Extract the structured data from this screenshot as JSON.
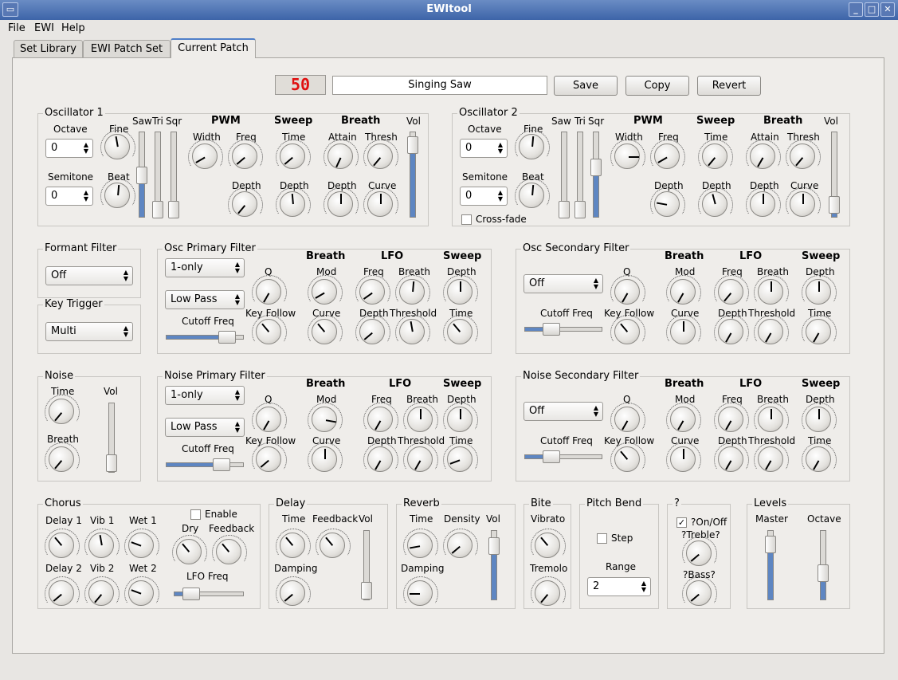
{
  "window": {
    "title": "EWItool",
    "min": "_",
    "max": "□",
    "close": "✕"
  },
  "menu": [
    "File",
    "EWI",
    "Help"
  ],
  "tabs": [
    "Set Library",
    "EWI Patch Set",
    "Current Patch"
  ],
  "patch": {
    "number": "50",
    "name": "Singing Saw",
    "save": "Save",
    "copy": "Copy",
    "revert": "Revert"
  },
  "osc1": {
    "title": "Oscillator 1",
    "octave": "Octave",
    "octave_val": "0",
    "semitone": "Semitone",
    "semitone_val": "0",
    "fine": "Fine",
    "beat": "Beat",
    "saw": "Saw",
    "tri": "Tri",
    "sqr": "Sqr",
    "pwm": "PWM",
    "sweep": "Sweep",
    "breath": "Breath",
    "vol": "Vol",
    "width": "Width",
    "freq": "Freq",
    "time": "Time",
    "attain": "Attain",
    "thresh": "Thresh",
    "depth": "Depth",
    "curve": "Curve"
  },
  "osc2": {
    "title": "Oscillator 2",
    "crossfade": "Cross-fade"
  },
  "formant": {
    "title": "Formant Filter",
    "value": "Off"
  },
  "keytrig": {
    "title": "Key Trigger",
    "value": "Multi"
  },
  "opf": {
    "title": "Osc Primary Filter",
    "mode": "1-only",
    "type": "Low Pass",
    "cutoff": "Cutoff Freq",
    "q": "Q",
    "keyfollow": "Key Follow",
    "breath": "Breath",
    "lfo": "LFO",
    "sweep": "Sweep",
    "mod": "Mod",
    "curve": "Curve",
    "freq": "Freq",
    "breath_l": "Breath",
    "depth": "Depth",
    "threshold": "Threshold",
    "time": "Time"
  },
  "osf": {
    "title": "Osc Secondary Filter",
    "mode": "Off"
  },
  "noise": {
    "title": "Noise",
    "time": "Time",
    "breath": "Breath",
    "vol": "Vol"
  },
  "npf": {
    "title": "Noise Primary Filter",
    "mode": "1-only",
    "type": "Low Pass"
  },
  "nsf": {
    "title": "Noise Secondary Filter",
    "mode": "Off"
  },
  "chorus": {
    "title": "Chorus",
    "delay1": "Delay 1",
    "vib1": "Vib 1",
    "wet1": "Wet 1",
    "delay2": "Delay 2",
    "vib2": "Vib 2",
    "wet2": "Wet 2",
    "enable": "Enable",
    "dry": "Dry",
    "feedback": "Feedback",
    "lfofreq": "LFO Freq"
  },
  "delay": {
    "title": "Delay",
    "time": "Time",
    "feedback": "Feedback",
    "vol": "Vol",
    "damping": "Damping"
  },
  "reverb": {
    "title": "Reverb",
    "time": "Time",
    "density": "Density",
    "vol": "Vol",
    "damping": "Damping"
  },
  "bite": {
    "title": "Bite",
    "vibrato": "Vibrato",
    "tremolo": "Tremolo"
  },
  "pitchbend": {
    "title": "Pitch Bend",
    "step": "Step",
    "range": "Range",
    "range_val": "2"
  },
  "unknown": {
    "title": "?",
    "onoff": "?On/Off",
    "treble": "?Treble?",
    "bass": "?Bass?"
  },
  "levels": {
    "title": "Levels",
    "master": "Master",
    "octave": "Octave"
  }
}
